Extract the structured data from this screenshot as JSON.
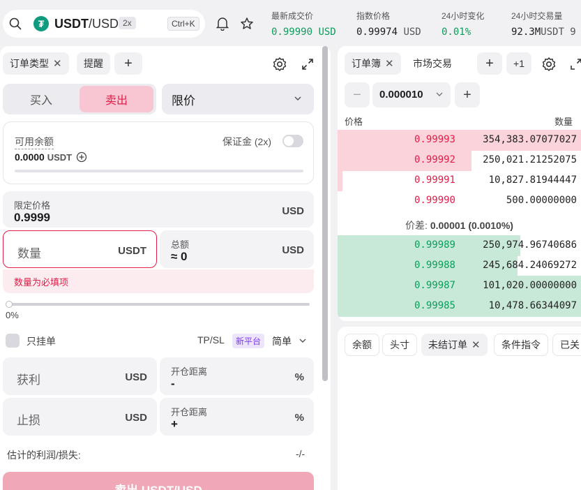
{
  "header": {
    "pair_base": "USDT",
    "pair_quote": "/USD",
    "leverage": "2x",
    "shortcut": "Ctrl+K",
    "stats": [
      {
        "label": "最新成交价",
        "value": "0.99990",
        "unit": "USD"
      },
      {
        "label": "指数价格",
        "value": "0.99974",
        "unit": "USD"
      },
      {
        "label": "24小时变化",
        "value": "0.01%",
        "unit": ""
      },
      {
        "label": "24小时交易量",
        "value": "92.3M",
        "unit": "USDT 9"
      }
    ]
  },
  "left": {
    "tabs": [
      {
        "label": "订单类型"
      },
      {
        "label": "提醒"
      }
    ],
    "side_buy": "买入",
    "side_sell": "卖出",
    "order_type": "限价",
    "balance_label": "可用余额",
    "balance_amount": "0.0000",
    "balance_unit": "USDT",
    "margin_label": "保证金 (2x)",
    "limit_price_label": "限定价格",
    "limit_price_value": "0.9999",
    "limit_price_unit": "USD",
    "qty_placeholder": "数量",
    "qty_unit": "USDT",
    "total_label": "总额",
    "total_value": "≈  0",
    "total_unit": "USD",
    "qty_error": "数量为必填项",
    "slider_pct": "0%",
    "post_only_label": "只挂单",
    "tpsl_label": "TP/SL",
    "new_badge": "新平台",
    "mode_label": "简单",
    "tp_label": "获利",
    "tp_unit": "USD",
    "tp_dist_label": "开仓距离",
    "tp_dist_sign": "-",
    "tp_dist_unit": "%",
    "sl_label": "止损",
    "sl_unit": "USD",
    "sl_dist_label": "开仓距离",
    "sl_dist_sign": "+",
    "sl_dist_unit": "%",
    "pnl_label": "估计的利润/损失:",
    "pnl_value": "-/-",
    "submit_label": "卖出 USDT/USD"
  },
  "orderbook": {
    "tabs": [
      {
        "label": "订单簿"
      },
      {
        "label": "市场交易"
      }
    ],
    "plus_one": "+1",
    "step": "0.000010",
    "col_price": "价格",
    "col_qty": "数量",
    "asks": [
      {
        "price": "0.99993",
        "qty": "354,383.07077027",
        "depth": 1.0
      },
      {
        "price": "0.99992",
        "qty": "250,021.21252075",
        "depth": 0.55
      },
      {
        "price": "0.99991",
        "qty": "10,827.81944447",
        "depth": 0.02
      },
      {
        "price": "0.99990",
        "qty": "500.00000000",
        "depth": 0.0
      }
    ],
    "spread_label": "价差:",
    "spread_value": "0.00001 (0.0010%)",
    "bids": [
      {
        "price": "0.99989",
        "qty": "250,974.96740686",
        "depth": 0.75
      },
      {
        "price": "0.99988",
        "qty": "245,684.24069272",
        "depth": 0.74
      },
      {
        "price": "0.99987",
        "qty": "101,020.00000000",
        "depth": 1.0
      },
      {
        "price": "0.99985",
        "qty": "10,478.66344097",
        "depth": 1.0
      }
    ]
  },
  "bottom_tabs": [
    {
      "label": "余额"
    },
    {
      "label": "头寸"
    },
    {
      "label": "未结订单"
    },
    {
      "label": "条件指令"
    },
    {
      "label": "已关"
    }
  ],
  "colors": {
    "ask": "#e11d48",
    "bid": "#0b9e5b",
    "ask_depth": "#fbd3db",
    "bid_depth": "#c8e8d8"
  }
}
